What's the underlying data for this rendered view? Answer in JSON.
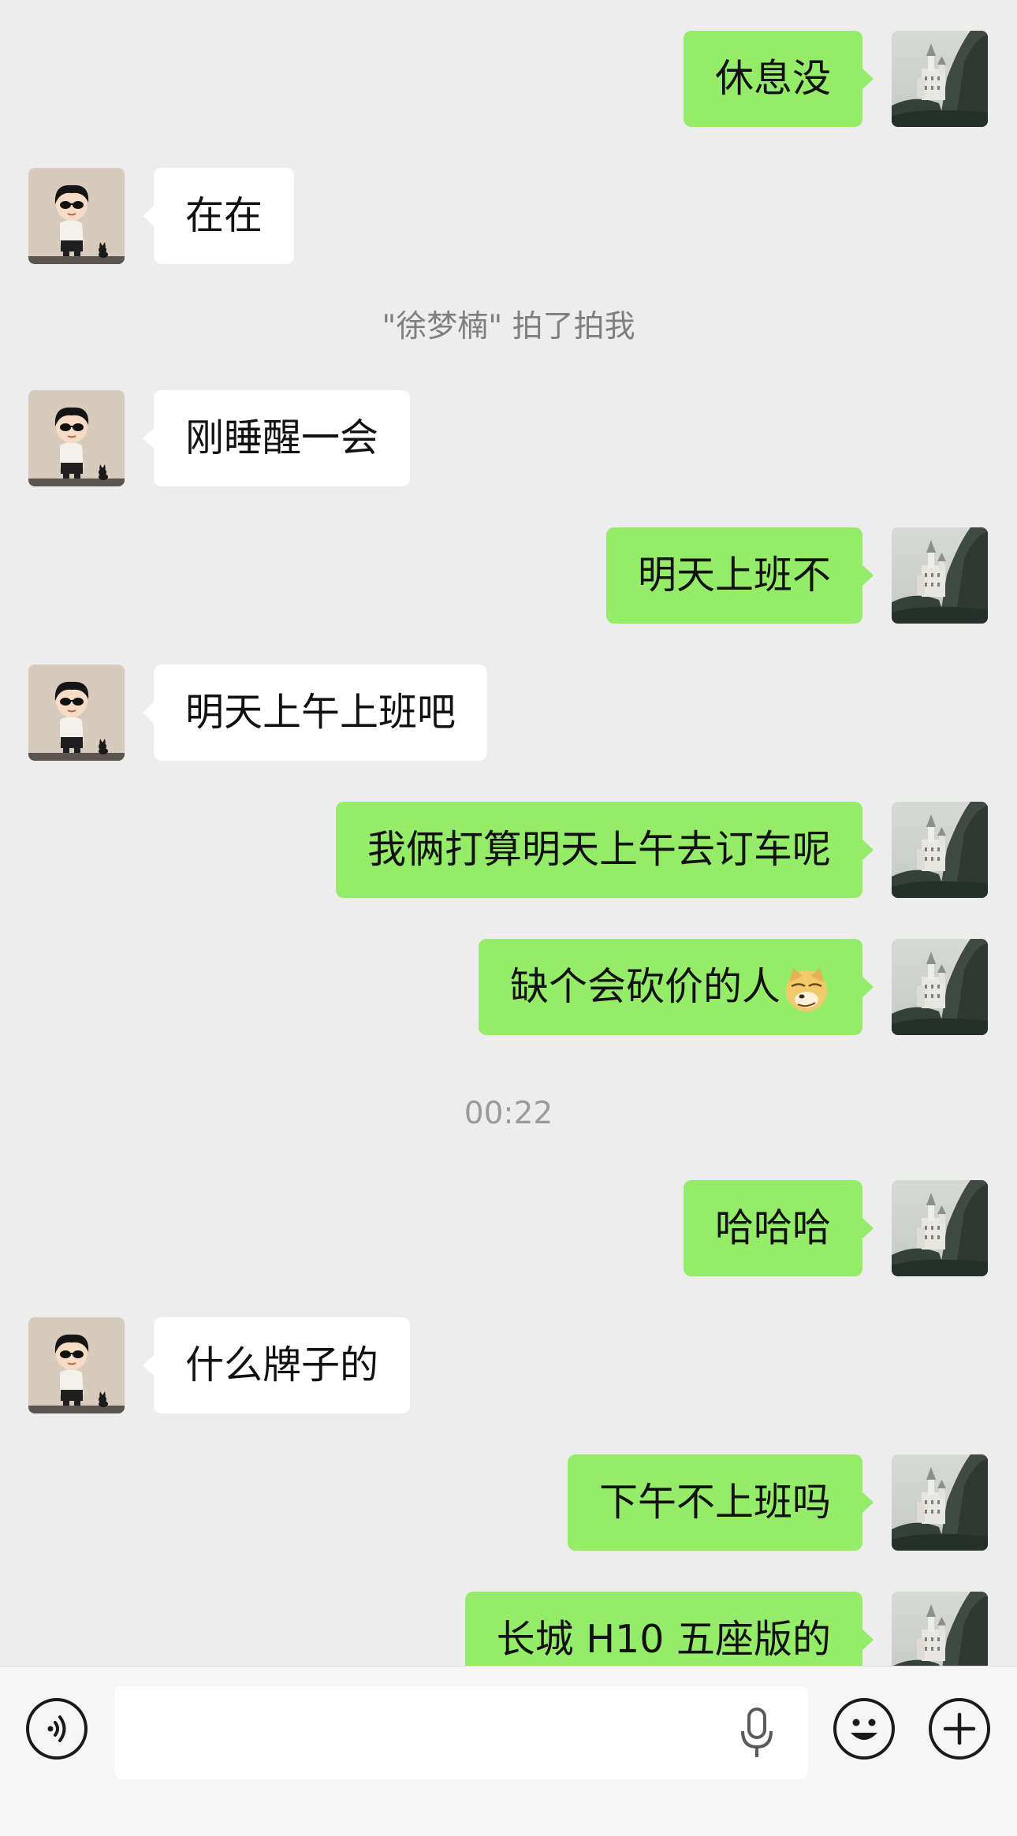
{
  "messages": [
    {
      "from": "me",
      "text": "休息没"
    },
    {
      "from": "them",
      "text": "在在"
    },
    {
      "system": "\"徐梦楠\" 拍了拍我"
    },
    {
      "from": "them",
      "text": "刚睡醒一会"
    },
    {
      "from": "me",
      "text": "明天上班不"
    },
    {
      "from": "them",
      "text": "明天上午上班吧"
    },
    {
      "from": "me",
      "text": "我俩打算明天上午去订车呢"
    },
    {
      "from": "me",
      "text": "缺个会砍价的人",
      "emoji": "doge-emoji"
    },
    {
      "system": "00:22"
    },
    {
      "from": "me",
      "text": "哈哈哈"
    },
    {
      "from": "them",
      "text": "什么牌子的"
    },
    {
      "from": "me",
      "text": "下午不上班吗"
    },
    {
      "from": "me",
      "text": "长城 H10 五座版的"
    }
  ],
  "input": {
    "value": "",
    "placeholder": ""
  },
  "icons": {
    "voice": "voice-icon",
    "mic": "microphone-icon",
    "emoji": "smiley-icon",
    "plus": "plus-icon",
    "my_avatar": "castle-photo-avatar",
    "their_avatar": "cartoon-boy-avatar"
  },
  "colors": {
    "background": "#ededed",
    "my_bubble": "#95ec69",
    "their_bubble": "#ffffff",
    "system_text": "#7f7f7f"
  }
}
